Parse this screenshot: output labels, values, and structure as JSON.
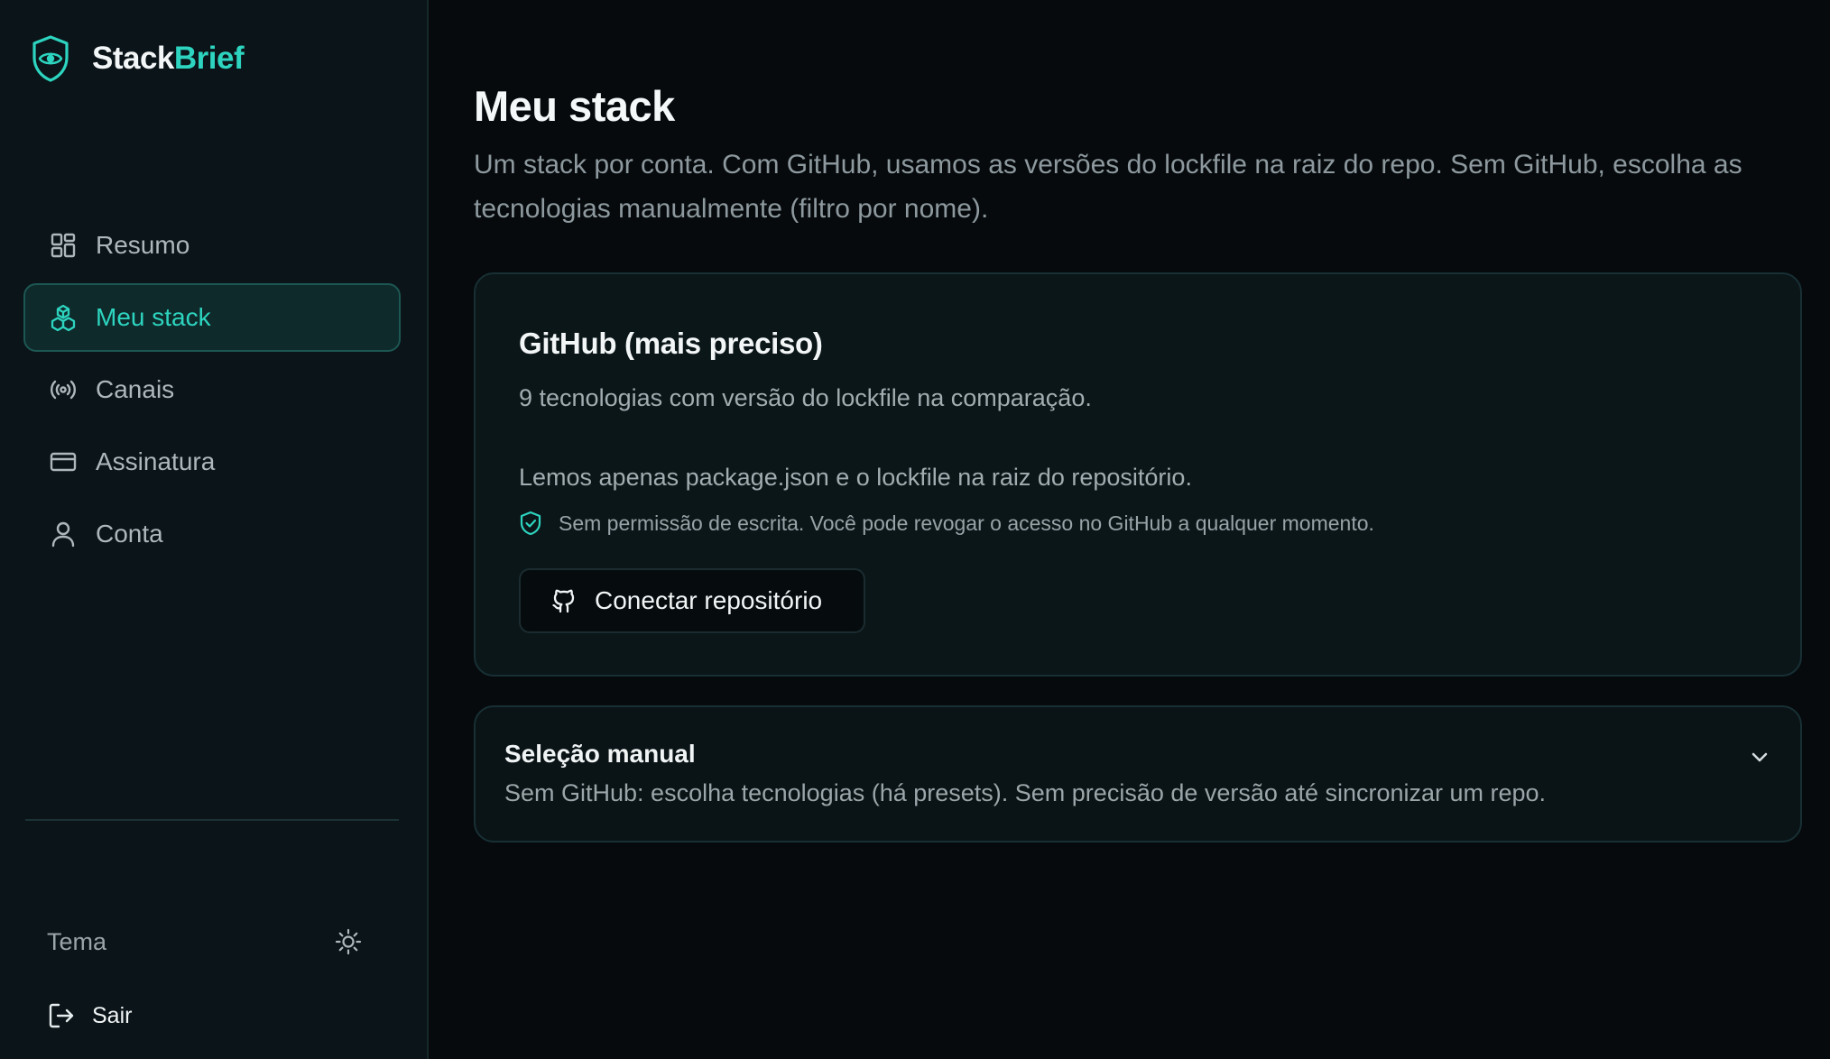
{
  "brand": {
    "name_part1": "Stack",
    "name_part2": "Brief",
    "logo_icon": "shield-eye-icon"
  },
  "colors": {
    "accent": "#2dd4bf",
    "background": "#060a0d",
    "sidebar": "#0b1418",
    "card": "#0b1619"
  },
  "sidebar": {
    "items": [
      {
        "label": "Resumo",
        "icon": "grid-icon",
        "active": false
      },
      {
        "label": "Meu stack",
        "icon": "cubes-icon",
        "active": true
      },
      {
        "label": "Canais",
        "icon": "broadcast-icon",
        "active": false
      },
      {
        "label": "Assinatura",
        "icon": "credit-card-icon",
        "active": false
      },
      {
        "label": "Conta",
        "icon": "user-icon",
        "active": false
      }
    ],
    "theme_label": "Tema",
    "theme_icon": "sun-icon",
    "logout_label": "Sair",
    "logout_icon": "logout-icon"
  },
  "main": {
    "title": "Meu stack",
    "description": "Um stack por conta. Com GitHub, usamos as versões do lockfile na raiz do repo. Sem GitHub, escolha as tecnologias manualmente (filtro por nome).",
    "github_card": {
      "title": "GitHub (mais preciso)",
      "count_text": "9 tecnologias com versão do lockfile na comparação.",
      "note": "Lemos apenas package.json e o lockfile na raiz do repositório.",
      "permission_note": "Sem permissão de escrita. Você pode revogar o acesso no GitHub a qualquer momento.",
      "connect_label": "Conectar repositório"
    },
    "manual_section": {
      "title": "Seleção manual",
      "description": "Sem GitHub: escolha tecnologias (há presets). Sem precisão de versão até sincronizar um repo.",
      "expanded": false
    }
  }
}
